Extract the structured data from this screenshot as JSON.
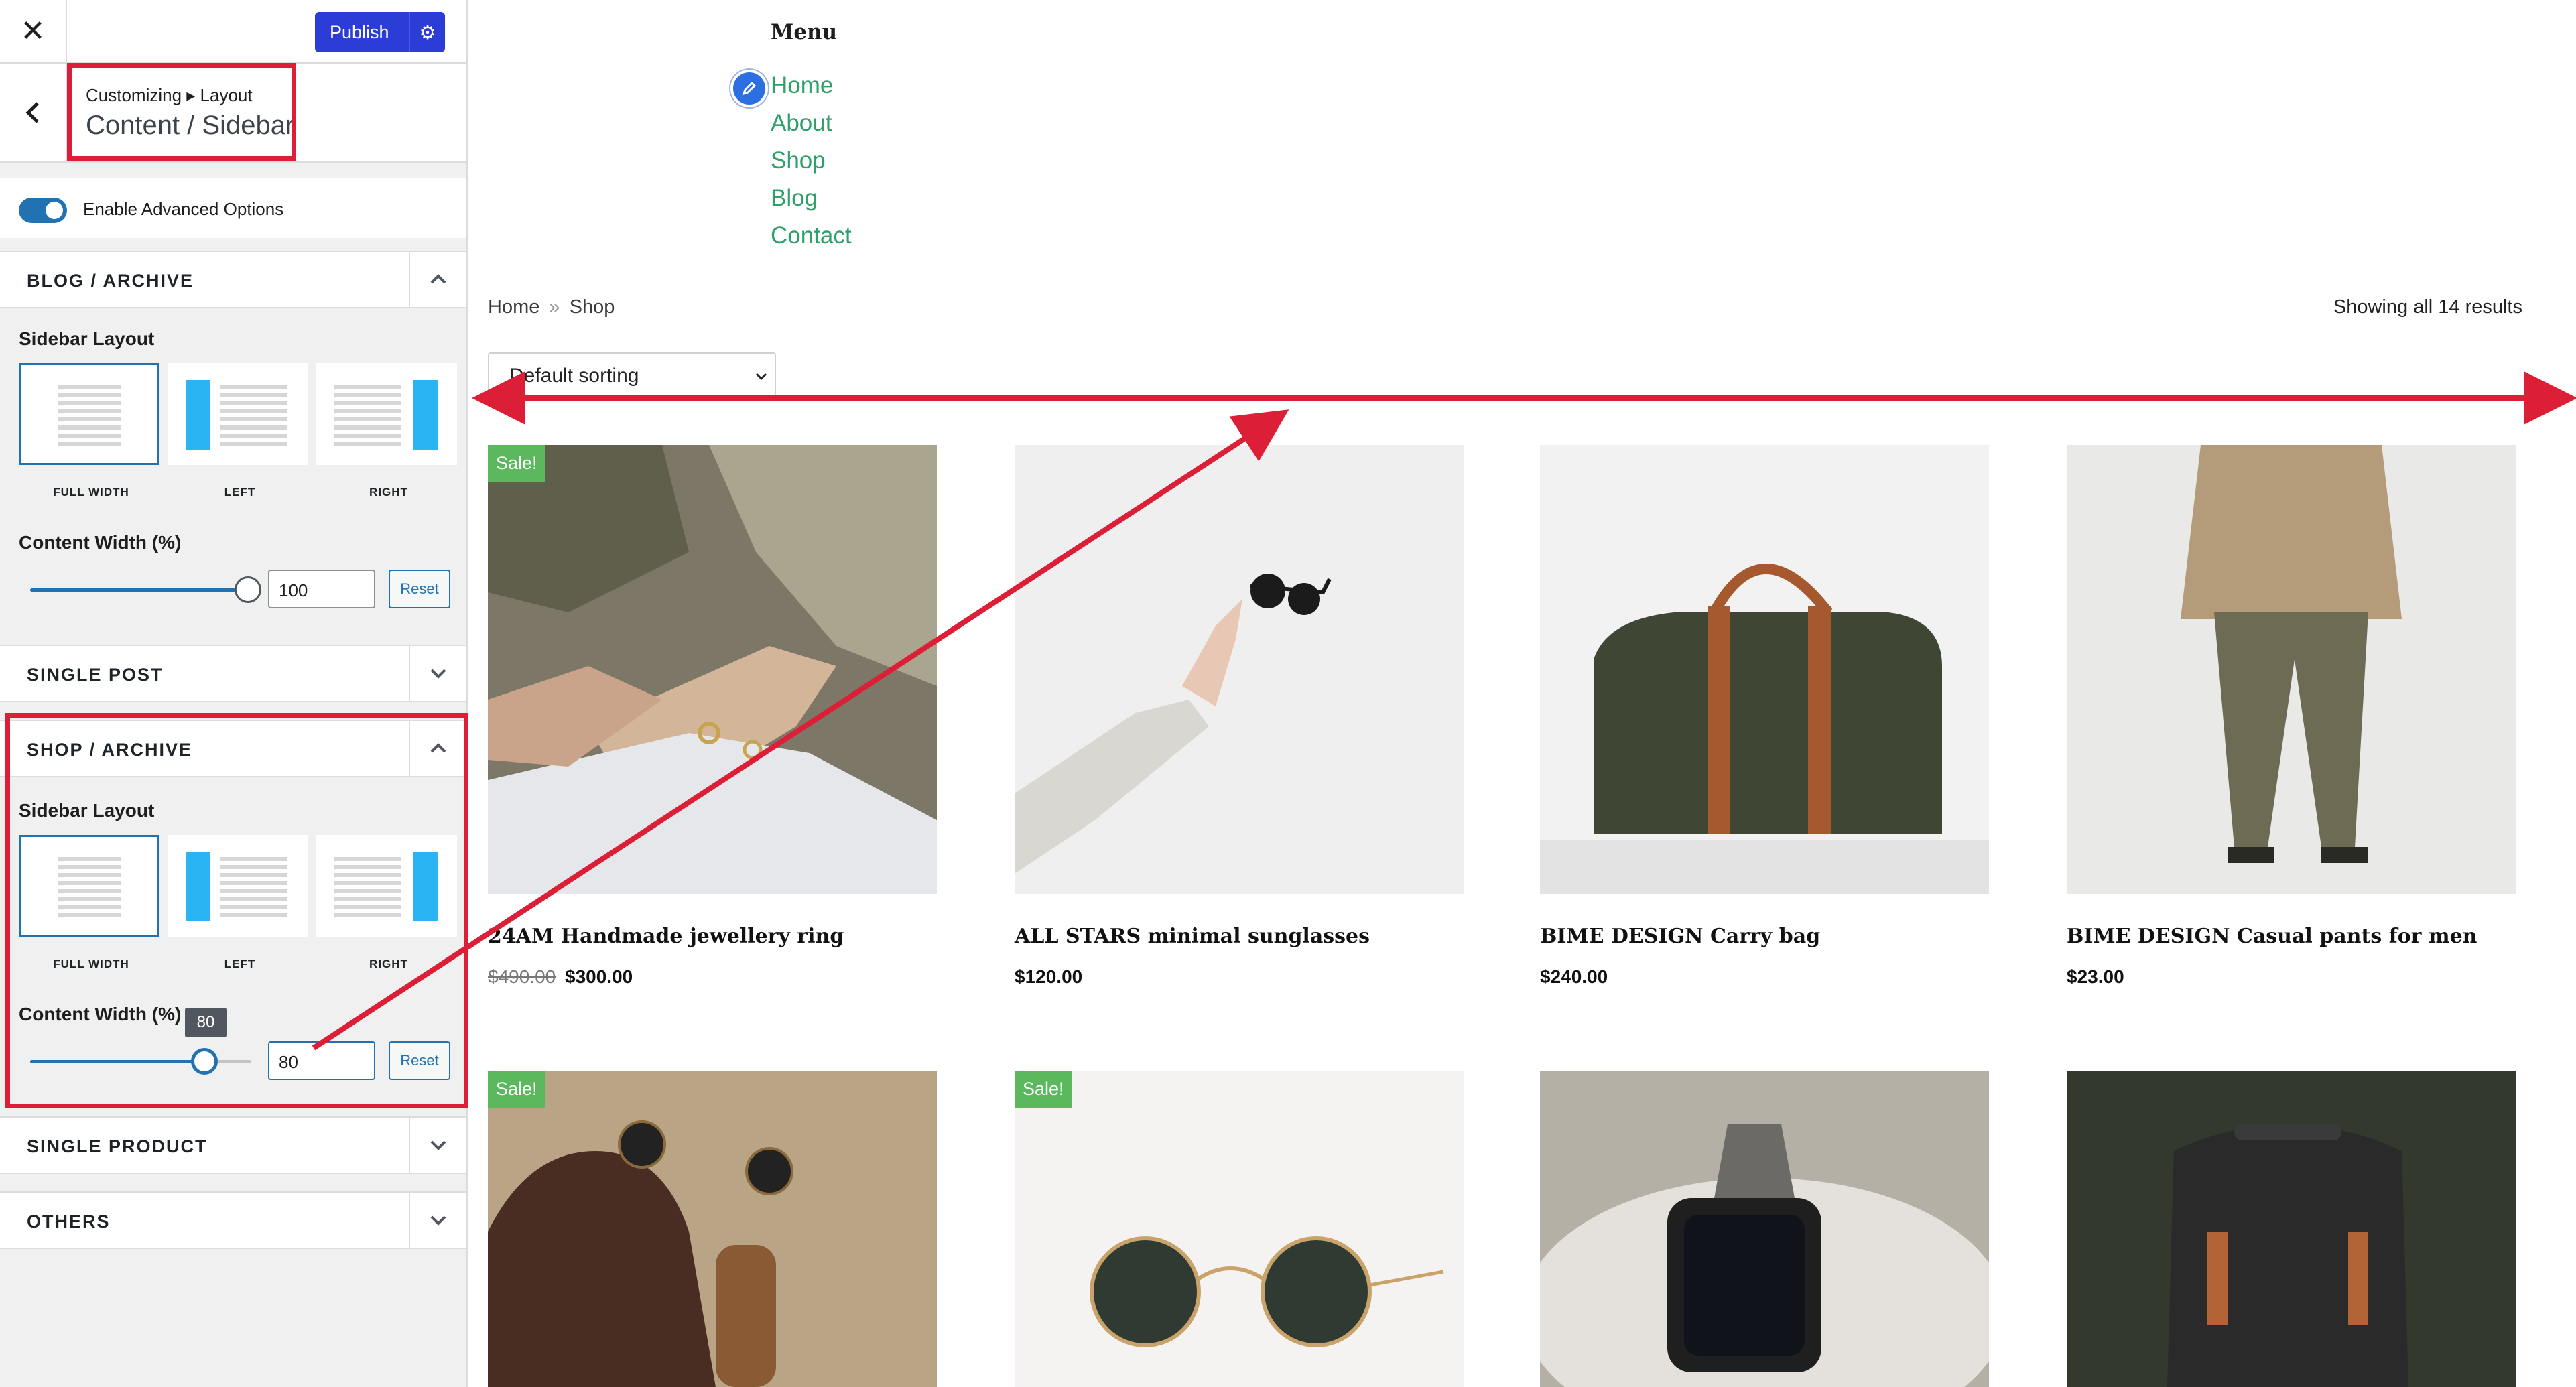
{
  "customizer": {
    "close_label": "✕",
    "publish_label": "Publish",
    "breadcrumb": "Customizing ▸ Layout",
    "section_title": "Content / Sidebar",
    "advanced_toggle_label": "Enable Advanced Options",
    "advanced_enabled": true,
    "accent_color": "#2271b1",
    "highlight_color": "#dc1e37",
    "sections": {
      "blog": {
        "title": "BLOG / ARCHIVE",
        "sidebar_layout_label": "Sidebar Layout",
        "options": [
          "FULL WIDTH",
          "LEFT",
          "RIGHT"
        ],
        "selected": "FULL WIDTH",
        "content_width_label": "Content Width (%)",
        "content_width": "100",
        "reset_label": "Reset"
      },
      "single_post": {
        "title": "SINGLE POST"
      },
      "shop": {
        "title": "SHOP / ARCHIVE",
        "sidebar_layout_label": "Sidebar Layout",
        "options": [
          "FULL WIDTH",
          "LEFT",
          "RIGHT"
        ],
        "selected": "FULL WIDTH",
        "content_width_label": "Content Width (%)",
        "content_width": "80",
        "tooltip": "80",
        "reset_label": "Reset"
      },
      "single_product": {
        "title": "SINGLE PRODUCT"
      },
      "others": {
        "title": "OTHERS"
      }
    }
  },
  "site": {
    "menu_title": "Menu",
    "menu": [
      "Home",
      "About",
      "Shop",
      "Blog",
      "Contact"
    ],
    "link_color": "#2fa06a",
    "breadcrumb": {
      "home": "Home",
      "sep": "»",
      "current": "Shop"
    },
    "result_count": "Showing all 14 results",
    "sorting": "Default sorting",
    "sale_badge": "Sale!",
    "sale_color": "#5cb85c",
    "products": [
      {
        "name": "24AM Handmade jewellery ring",
        "old_price": "$490.00",
        "price": "$300.00"
      },
      {
        "name": "ALL STARS minimal sunglasses",
        "price": "$120.00"
      },
      {
        "name": "BIME DESIGN Carry bag",
        "price": "$240.00"
      },
      {
        "name": "BIME DESIGN Casual pants for men",
        "price": "$23.00"
      }
    ]
  }
}
